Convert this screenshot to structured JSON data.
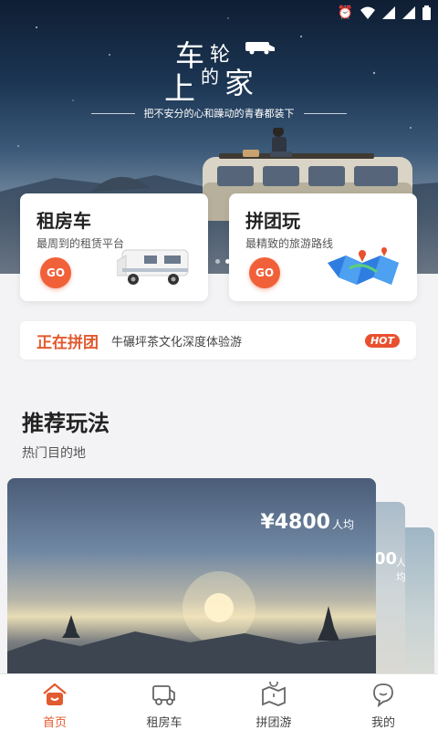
{
  "hero": {
    "brand_chars": [
      "车",
      "轮",
      "上",
      "的",
      "家"
    ],
    "slogan": "把不安分的心和躁动的青春都装下",
    "slides": 3,
    "active_slide": 1
  },
  "services": [
    {
      "title": "租房车",
      "subtitle": "最周到的租赁平台",
      "go": "GO"
    },
    {
      "title": "拼团玩",
      "subtitle": "最精致的旅游路线",
      "go": "GO"
    }
  ],
  "pintuan": {
    "label": "正在拼团",
    "text": "牛碾坪茶文化深度体验游",
    "badge": "HOT"
  },
  "recommend": {
    "title": "推荐玩法",
    "subtitle": "热门目的地",
    "main_card": {
      "price": "¥4800",
      "unit": "人均"
    },
    "peek_card": {
      "price": "00",
      "unit": "人均"
    }
  },
  "tabs": [
    {
      "label": "首页",
      "icon": "home-icon",
      "active": true
    },
    {
      "label": "租房车",
      "icon": "rv-icon",
      "active": false
    },
    {
      "label": "拼团游",
      "icon": "map-icon",
      "active": false
    },
    {
      "label": "我的",
      "icon": "profile-icon",
      "active": false
    }
  ],
  "colors": {
    "accent": "#e25a2f",
    "go_button": "#f0613a",
    "hot_badge": "#e9502f"
  }
}
